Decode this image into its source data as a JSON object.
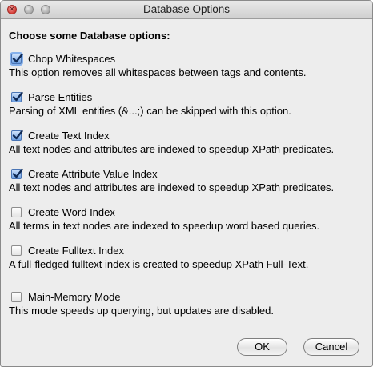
{
  "window": {
    "title": "Database Options"
  },
  "heading": "Choose some Database options:",
  "options": [
    {
      "label": "Chop Whitespaces",
      "checked": true,
      "description": "This option removes all whitespaces between tags and contents."
    },
    {
      "label": "Parse Entities",
      "checked": true,
      "description": "Parsing of XML entities (&...;) can be skipped with this option."
    },
    {
      "label": "Create Text Index",
      "checked": true,
      "description": "All text nodes and attributes are indexed to speedup XPath predicates."
    },
    {
      "label": "Create Attribute Value Index",
      "checked": true,
      "description": "All text nodes and attributes are indexed to speedup XPath predicates."
    },
    {
      "label": "Create Word Index",
      "checked": false,
      "description": "All terms in text nodes are indexed to speedup word based queries."
    },
    {
      "label": "Create Fulltext Index",
      "checked": false,
      "description": "A full-fledged fulltext index is created to speedup XPath Full-Text."
    },
    {
      "label": "Main-Memory Mode",
      "checked": false,
      "description": "This mode speeds up querying, but updates are disabled."
    }
  ],
  "buttons": {
    "ok": "OK",
    "cancel": "Cancel"
  },
  "icons": {
    "close": "close-window-icon",
    "minimize": "minimize-window-icon",
    "zoom": "zoom-window-icon",
    "check": "checkmark-icon"
  },
  "colors": {
    "accent": "#4a75b5",
    "window_bg": "#ededed",
    "close": "#d43b34"
  }
}
